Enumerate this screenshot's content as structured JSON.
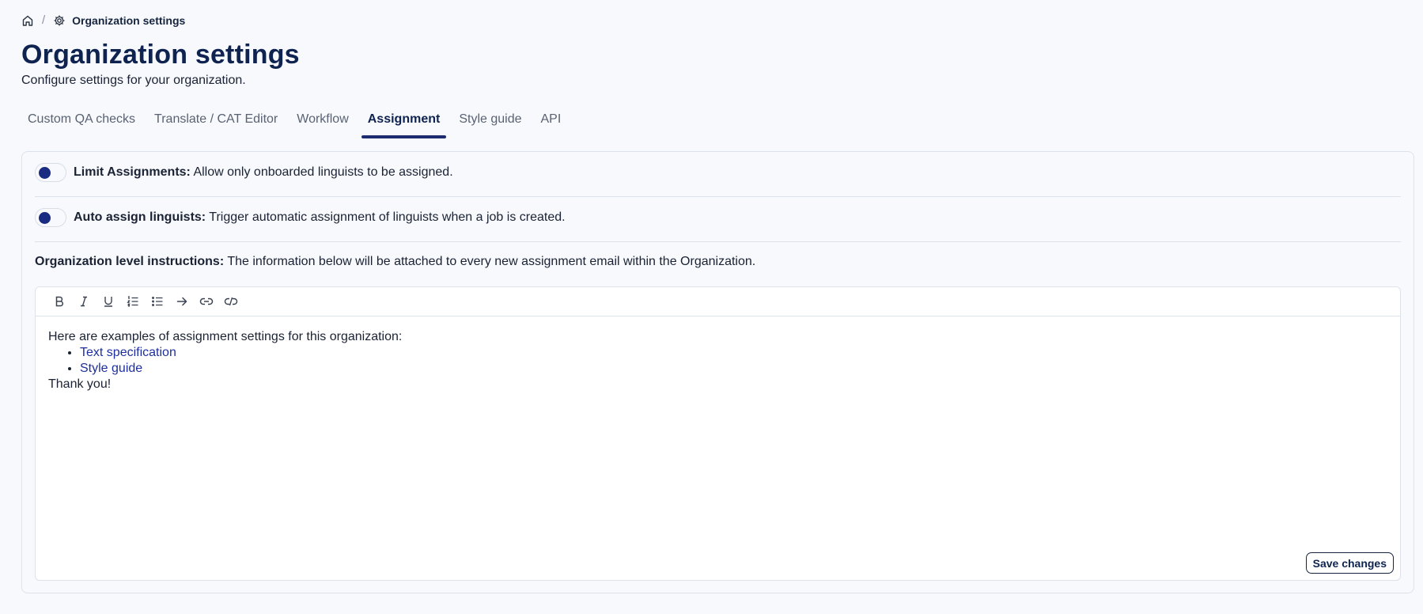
{
  "breadcrumb": {
    "home_icon": "home-icon",
    "separator": "/",
    "current_icon": "gear-icon",
    "current_label": "Organization settings"
  },
  "header": {
    "title": "Organization settings",
    "subtitle": "Configure settings for your organization."
  },
  "tabs": [
    {
      "label": "Custom QA checks",
      "active": false
    },
    {
      "label": "Translate / CAT Editor",
      "active": false
    },
    {
      "label": "Workflow",
      "active": false
    },
    {
      "label": "Assignment",
      "active": true
    },
    {
      "label": "Style guide",
      "active": false
    },
    {
      "label": "API",
      "active": false
    }
  ],
  "settings": {
    "limit_assignments": {
      "label": "Limit Assignments:",
      "description": "Allow only onboarded linguists to be assigned."
    },
    "auto_assign": {
      "label": "Auto assign linguists:",
      "description": "Trigger automatic assignment of linguists when a job is created."
    },
    "instructions": {
      "label": "Organization level instructions:",
      "description": "The information below will be attached to every new assignment email within the Organization."
    }
  },
  "toolbar": [
    "bold-icon",
    "italic-icon",
    "underline-icon",
    "ordered-list-icon",
    "bullet-list-icon",
    "arrow-right-icon",
    "link-icon",
    "unlink-icon"
  ],
  "editor": {
    "intro": "Here are examples of assignment settings for this organization:",
    "links": [
      "Text specification",
      "Style guide"
    ],
    "outro": "Thank you!"
  },
  "actions": {
    "save_label": "Save changes"
  },
  "colors": {
    "accent": "#1d2c72",
    "link": "#1d2fa0",
    "title": "#0f2350"
  }
}
